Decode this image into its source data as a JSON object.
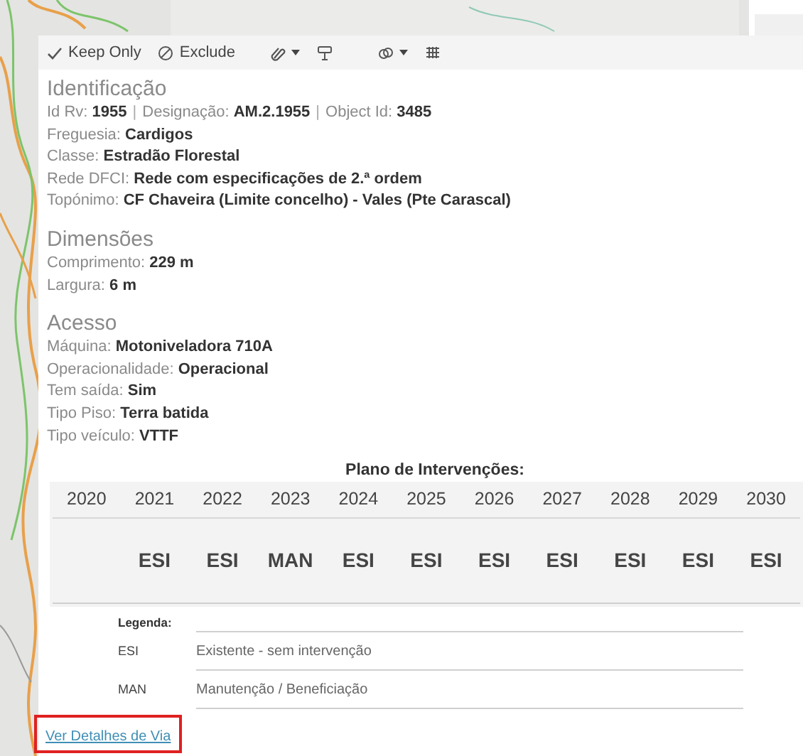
{
  "toolbar": [
    {
      "kind": "keep",
      "label": "Keep Only"
    },
    {
      "kind": "exclude",
      "label": "Exclude"
    },
    {
      "kind": "clip",
      "caret": true
    },
    {
      "kind": "highlight",
      "caret": false
    },
    {
      "kind": "group",
      "caret": true
    },
    {
      "kind": "grid",
      "caret": false
    }
  ],
  "sections": [
    {
      "title": "Identificação",
      "lines": [
        [
          {
            "label": "Id Rv:",
            "value": "1955"
          },
          {
            "separator": "|",
            "label": "Designação:",
            "value": "AM.2.1955"
          },
          {
            "separator": "|",
            "label": "Object Id:",
            "value": "3485"
          }
        ],
        [
          {
            "label": "Freguesia:",
            "value": "Cardigos"
          }
        ],
        [
          {
            "label": "Classe:",
            "value": "Estradão Florestal"
          }
        ],
        [
          {
            "label": "Rede DFCI:",
            "value": "Rede com especificações de 2.ª ordem"
          }
        ],
        [
          {
            "label": "Topónimo:",
            "value": "CF Chaveira (Limite concelho) - Vales (Pte Carascal)"
          }
        ]
      ]
    },
    {
      "title": "Dimensões",
      "lines": [
        [
          {
            "label": "Comprimento:",
            "value": "229 m"
          }
        ],
        [
          {
            "label": "Largura:",
            "value": "6 m"
          }
        ]
      ]
    },
    {
      "title": "Acesso",
      "lines": [
        [
          {
            "label": "Máquina:",
            "value": "Motoniveladora 710A"
          }
        ],
        [
          {
            "label": "Operacionalidade:",
            "value": "Operacional"
          }
        ],
        [
          {
            "label": "Tem saída:",
            "value": "Sim"
          }
        ],
        [
          {
            "label": "Tipo Piso:",
            "value": "Terra batida"
          }
        ],
        [
          {
            "label": "Tipo veículo:",
            "value": "VTTF"
          }
        ]
      ]
    }
  ],
  "plan": {
    "title": "Plano de Intervenções:",
    "years": [
      {
        "year": "2020"
      },
      {
        "year": "2021",
        "value": "ESI"
      },
      {
        "year": "2022",
        "value": "ESI"
      },
      {
        "year": "2023",
        "value": "MAN"
      },
      {
        "year": "2024",
        "value": "ESI"
      },
      {
        "year": "2025",
        "value": "ESI"
      },
      {
        "year": "2026",
        "value": "ESI"
      },
      {
        "year": "2027",
        "value": "ESI"
      },
      {
        "year": "2028",
        "value": "ESI"
      },
      {
        "year": "2029",
        "value": "ESI"
      },
      {
        "year": "2030",
        "value": "ESI"
      }
    ]
  },
  "legend": {
    "title": "Legenda:",
    "items": [
      {
        "code": "ESI",
        "description": "Existente - sem intervenção"
      },
      {
        "code": "MAN",
        "description": "Manutenção / Beneficiação"
      }
    ]
  },
  "link": {
    "label": "Ver Detalhes de Via"
  }
}
